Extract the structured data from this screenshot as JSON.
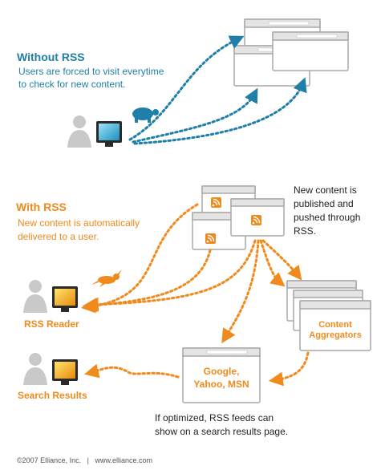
{
  "without_rss": {
    "title": "Without RSS",
    "line1": "Users are forced to visit everytime",
    "line2": "to check for new content."
  },
  "with_rss": {
    "title": "With RSS",
    "line1": "New content is automatically",
    "line2": "delivered to a user."
  },
  "publish_note": {
    "line1": "New content is",
    "line2": "published and",
    "line3": "pushed through",
    "line4": "RSS."
  },
  "labels": {
    "rss_reader": "RSS Reader",
    "search_results": "Search Results",
    "aggregators_line1": "Content",
    "aggregators_line2": "Aggregators",
    "engines_line1": "Google,",
    "engines_line2": "Yahoo, MSN"
  },
  "search_note": {
    "line1": "If optimized, RSS feeds can",
    "line2": "show on a search results page."
  },
  "footer": "©2007 Elliance, Inc.   |   www.elliance.com",
  "colors": {
    "blue": "#1f7fa8",
    "orange": "#f08a1c",
    "window_border": "#a9a9a9",
    "window_bar": "#e4e4e4"
  },
  "icons": [
    "person-icon",
    "monitor-icon",
    "turtle-icon",
    "rabbit-icon",
    "rss-feed-icon",
    "browser-window-icon"
  ]
}
